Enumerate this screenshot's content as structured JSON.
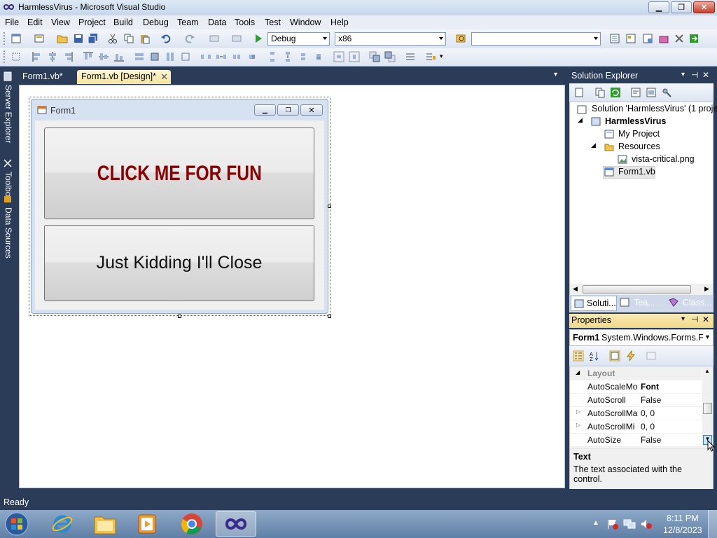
{
  "window": {
    "title": "HarmlessVirus - Microsoft Visual Studio"
  },
  "menu": [
    "File",
    "Edit",
    "View",
    "Project",
    "Build",
    "Debug",
    "Team",
    "Data",
    "Tools",
    "Test",
    "Window",
    "Help"
  ],
  "toolbar": {
    "config": "Debug",
    "platform": "x86",
    "find": ""
  },
  "side_tabs": [
    "Server Explorer",
    "Toolbox",
    "Data Sources"
  ],
  "doc_tabs": [
    {
      "label": "Form1.vb*"
    },
    {
      "label": "Form1.vb [Design]*"
    }
  ],
  "form": {
    "title": "Form1",
    "button1": "CLICK ME FOR FUN",
    "button2": "Just Kidding I'll Close"
  },
  "solution_explorer": {
    "title": "Solution Explorer",
    "items": [
      "Solution 'HarmlessVirus' (1 proje",
      "HarmlessVirus",
      "My Project",
      "Resources",
      "vista-critical.png",
      "Form1.vb"
    ],
    "tabs": [
      "Soluti...",
      "Tea...",
      "Class..."
    ]
  },
  "properties": {
    "title": "Properties",
    "object": "Form1",
    "object_type": "System.Windows.Forms.Fo",
    "category": "Layout",
    "rows": [
      {
        "name": "AutoScaleMo",
        "value": "Font"
      },
      {
        "name": "AutoScroll",
        "value": "False"
      },
      {
        "name": "AutoScrollMa",
        "value": "0, 0"
      },
      {
        "name": "AutoScrollMi",
        "value": "0, 0"
      },
      {
        "name": "AutoSize",
        "value": "False"
      }
    ],
    "desc_title": "Text",
    "desc_text": "The text associated with the control."
  },
  "status": "Ready",
  "clock": {
    "time": "8:11 PM",
    "date": "12/8/2023"
  },
  "colors": {
    "accent_red": "#8b0000",
    "chrome": "#2b3c59",
    "panel_header": "#f2d889"
  }
}
